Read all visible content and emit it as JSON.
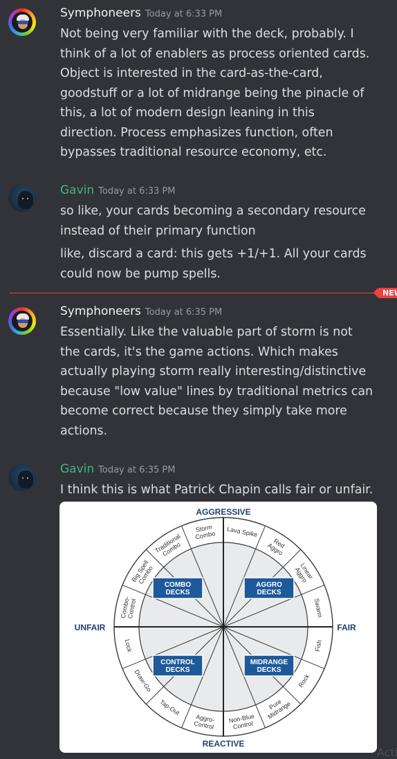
{
  "messages": [
    {
      "author": "Symphoneers",
      "time": "Today at 6:33 PM",
      "lines": [
        "Not being very familiar with the deck, probably. I",
        "think of a lot of enablers as process oriented cards.",
        "Object is interested in the card-as-the-card,",
        "goodstuff or a lot of midrange being the pinacle of",
        "this, a lot of modern design leaning in this",
        "direction. Process emphasizes function, often",
        "bypasses traditional resource economy, etc."
      ]
    },
    {
      "author": "Gavin",
      "time": "Today at 6:33 PM",
      "lines": [
        "so like, your cards becoming a secondary resource",
        "instead of their primary function"
      ],
      "followup_lines": [
        "like, discard a card: this gets +1/+1. All your cards",
        "could now be pump spells."
      ]
    },
    {
      "author": "Symphoneers",
      "time": "Today at 6:35 PM",
      "lines": [
        "Essentially. Like the valuable part of storm is not",
        "the cards, it's the game actions. Which makes",
        "actually playing storm really interesting/distinctive",
        "because \"low value\" lines by traditional metrics can",
        "become correct because they simply take more",
        "actions."
      ]
    },
    {
      "author": "Gavin",
      "time": "Today at 6:35 PM",
      "lines": [
        "I think this is what Patrick Chapin calls fair or unfair."
      ]
    }
  ],
  "new_badge": "NEW",
  "diagram": {
    "top": "AGGRESSIVE",
    "bottom": "REACTIVE",
    "left": "UNFAIR",
    "right": "FAIR",
    "quadrants": [
      [
        "COMBO",
        "DECKS"
      ],
      [
        "AGGRO",
        "DECKS"
      ],
      [
        "CONTROL",
        "DECKS"
      ],
      [
        "MIDRANGE",
        "DECKS"
      ]
    ],
    "segments": [
      [
        "Lava Spike"
      ],
      [
        "Red",
        "Aggro"
      ],
      [
        "Linear",
        "Aggro"
      ],
      [
        "Swarm"
      ],
      [
        "Fish"
      ],
      [
        "Rock"
      ],
      [
        "Pure",
        "Midrange"
      ],
      [
        "Non-Blue",
        "Control"
      ],
      [
        "Aggro-",
        "Control"
      ],
      [
        "Tap-Out"
      ],
      [
        "Draw-Go"
      ],
      [
        "Lock"
      ],
      [
        "Combo-",
        "Control"
      ],
      [
        "Big Spell",
        "Combo"
      ],
      [
        "Traditional",
        "Combo"
      ],
      [
        "Storm",
        "Combo"
      ]
    ],
    "colors": {
      "ring_fill": "#e9eaeb",
      "stroke": "#3a3a3a",
      "box_fill": "#1e5a9a",
      "label": "#1f3f6e"
    }
  },
  "watermark": "Acti"
}
